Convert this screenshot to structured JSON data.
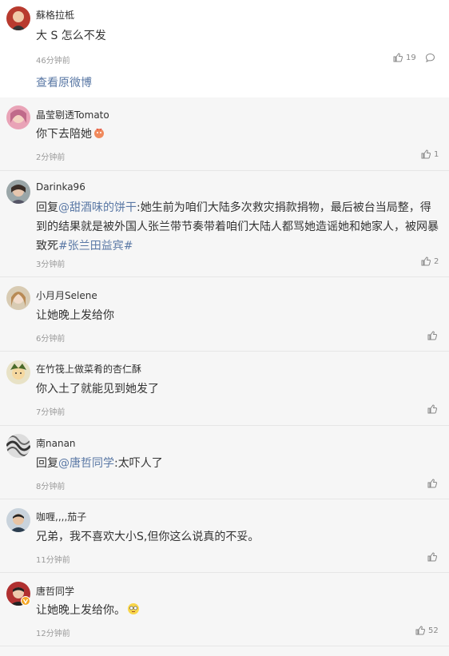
{
  "top_comment": {
    "username": "蘇格拉柢",
    "content": "大 S 怎么不发",
    "time": "46分钟前",
    "likes": "19",
    "view_original": "查看原微博"
  },
  "comments": [
    {
      "username": "晶莹剔透Tomato",
      "content_parts": [
        "你下去陪她"
      ],
      "has_emoji": true,
      "time": "2分钟前",
      "likes": "1"
    },
    {
      "username": "Darinka96",
      "reply_prefix": "回复",
      "reply_to": "@甜酒味的饼干",
      "content": ":她生前为咱们大陆多次救灾捐款捐物，最后被台当局整，得到的结果就是被外国人张兰带节奏带着咱们大陆人都骂她造谣她和她家人，被网暴致死",
      "hashtag": "#张兰田益宾#",
      "time": "3分钟前",
      "likes": "2"
    },
    {
      "username": "小月月Selene",
      "content": "让她晚上发给你",
      "time": "6分钟前",
      "likes": ""
    },
    {
      "username": "在竹筏上做菜肴的杏仁酥",
      "content": "你入土了就能见到她发了",
      "time": "7分钟前",
      "likes": ""
    },
    {
      "username": "南nanan",
      "reply_prefix": "回复",
      "reply_to": "@唐哲同学",
      "content": ":太吓人了",
      "time": "8分钟前",
      "likes": ""
    },
    {
      "username": "咖喱,,,,茄子",
      "content": "兄弟，我不喜欢大小S,但你这么说真的不妥。",
      "time": "11分钟前",
      "likes": ""
    },
    {
      "username": "唐哲同学",
      "content": "让她晚上发给你。",
      "has_emoji": true,
      "time": "12分钟前",
      "likes": "52"
    }
  ],
  "colors": {
    "link": "#5a78a5",
    "background": "#f6f6f6",
    "card": "#ffffff"
  }
}
